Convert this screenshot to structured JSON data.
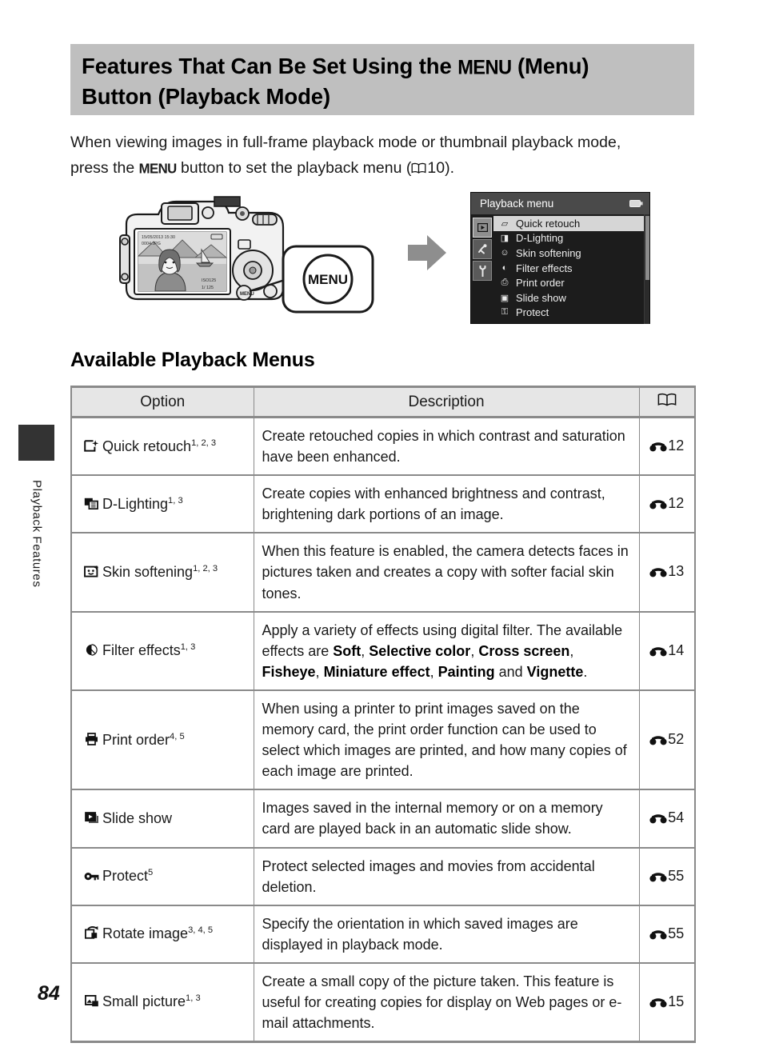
{
  "sidebar": {
    "chapter_label": "Playback Features"
  },
  "header": {
    "title_part1": "Features That Can Be Set Using the ",
    "title_menu_glyph": "MENU",
    "title_part2": " (Menu)",
    "title_line2": "Button (Playback Mode)"
  },
  "intro": {
    "line1": "When viewing images in full-frame playback mode or thumbnail playback mode,",
    "line2_a": "press the ",
    "line2_menu": "MENU",
    "line2_b": " button to set the playback menu (",
    "line2_page": "10",
    "line2_c": ")."
  },
  "figure": {
    "camera_alt": "camera-rear-illustration",
    "callout_label": "MENU",
    "lcd_date": "15/05/2013 15:30",
    "lcd_file": "0004.JPG",
    "lcd_iso": "ISO 125",
    "lcd_shutter": "1/ 125",
    "arrow": "arrow-right"
  },
  "lcd_menu": {
    "title": "Playback menu",
    "battery_icon": "battery-icon",
    "tabs": [
      {
        "name": "playback-tab",
        "glyph": "▶",
        "active": true
      },
      {
        "name": "wireless-tab",
        "glyph": "✦",
        "active": false
      },
      {
        "name": "setup-tab",
        "glyph": "⚒",
        "active": false
      }
    ],
    "items": [
      {
        "label": "Quick retouch",
        "icon": "quick-retouch-icon",
        "glyph": "✦",
        "selected": true
      },
      {
        "label": "D-Lighting",
        "icon": "d-lighting-icon",
        "glyph": "◨",
        "selected": false
      },
      {
        "label": "Skin softening",
        "icon": "skin-softening-icon",
        "glyph": "☺",
        "selected": false
      },
      {
        "label": "Filter effects",
        "icon": "filter-effects-icon",
        "glyph": "◑",
        "selected": false
      },
      {
        "label": "Print order",
        "icon": "print-order-icon",
        "glyph": "⎙",
        "selected": false
      },
      {
        "label": "Slide show",
        "icon": "slide-show-icon",
        "glyph": "▶",
        "selected": false
      },
      {
        "label": "Protect",
        "icon": "protect-icon",
        "glyph": "⚿",
        "selected": false
      }
    ]
  },
  "section": {
    "heading": "Available Playback Menus"
  },
  "table": {
    "headers": {
      "option": "Option",
      "description": "Description",
      "reference": "book-icon"
    },
    "rows": [
      {
        "icon": "quick-retouch-icon",
        "option": "Quick retouch",
        "sup": "1, 2, 3",
        "description": "Create retouched copies in which contrast and saturation have been enhanced.",
        "ref": "12"
      },
      {
        "icon": "d-lighting-icon",
        "option": "D-Lighting",
        "sup": "1, 3",
        "description": "Create copies with enhanced brightness and contrast, brightening dark portions of an image.",
        "ref": "12"
      },
      {
        "icon": "skin-softening-icon",
        "option": "Skin softening",
        "sup": "1, 2, 3",
        "description": "When this feature is enabled, the camera detects faces in pictures taken and creates a copy with softer facial skin tones.",
        "ref": "13"
      },
      {
        "icon": "filter-effects-icon",
        "option": "Filter effects",
        "sup": "1, 3",
        "description_rich": true,
        "description": "Apply a variety of effects using digital filter. The available effects are Soft, Selective color, Cross screen, Fisheye, Miniature effect, Painting and Vignette.",
        "bold_terms": [
          "Soft",
          "Selective color",
          "Cross screen",
          "Fisheye",
          "Miniature effect",
          "Painting",
          "Vignette"
        ],
        "ref": "14"
      },
      {
        "icon": "print-order-icon",
        "option": "Print order",
        "sup": "4, 5",
        "description": "When using a printer to print images saved on the memory card, the print order function can be used to select which images are printed, and how many copies of each image are printed.",
        "ref": "52"
      },
      {
        "icon": "slide-show-icon",
        "option": "Slide show",
        "sup": "",
        "description": "Images saved in the internal memory or on a memory card are played back in an automatic slide show.",
        "ref": "54"
      },
      {
        "icon": "protect-icon",
        "option": "Protect",
        "sup": "5",
        "description": "Protect selected images and movies from accidental deletion.",
        "ref": "55"
      },
      {
        "icon": "rotate-image-icon",
        "option": "Rotate image",
        "sup": "3, 4, 5",
        "description": "Specify the orientation in which saved images are displayed in playback mode.",
        "ref": "55"
      },
      {
        "icon": "small-picture-icon",
        "option": "Small picture",
        "sup": "1, 3",
        "description": "Create a small copy of the picture taken. This feature is useful for creating copies for display on Web pages or e-mail attachments.",
        "ref": "15"
      }
    ]
  },
  "footer": {
    "page_number": "84"
  }
}
